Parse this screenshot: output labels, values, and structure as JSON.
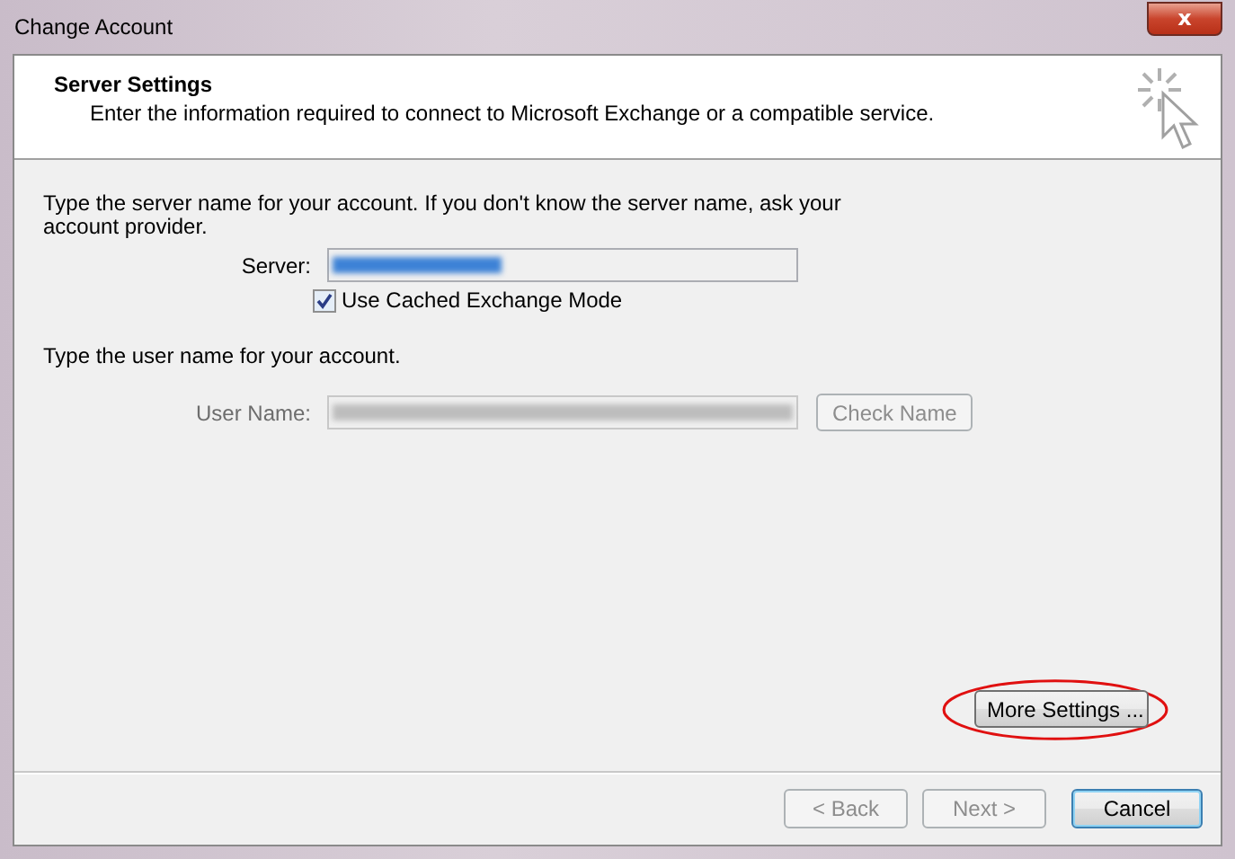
{
  "window": {
    "title": "Change Account",
    "close_label": "x"
  },
  "header": {
    "title": "Server Settings",
    "subtitle": "Enter the information required to connect to Microsoft Exchange or a compatible service."
  },
  "server_section": {
    "instruction": "Type the server name for your account. If you don't know the server name, ask your account provider.",
    "label": "Server:",
    "value_redacted": true,
    "value_selected": true,
    "disabled": false
  },
  "cached_mode": {
    "label": "Use Cached Exchange Mode",
    "checked": true
  },
  "user_section": {
    "instruction": "Type the user name for your account.",
    "label": "User Name:",
    "value_redacted": true,
    "disabled": true,
    "check_button": {
      "label": "Check Name",
      "disabled": true
    }
  },
  "more_settings": {
    "label": "More Settings ...",
    "circled": true
  },
  "buttons": [
    {
      "label": "< Back",
      "disabled": true,
      "default": false
    },
    {
      "label": "Next >",
      "disabled": true,
      "default": false
    },
    {
      "label": "Cancel",
      "disabled": false,
      "default": true
    }
  ]
}
